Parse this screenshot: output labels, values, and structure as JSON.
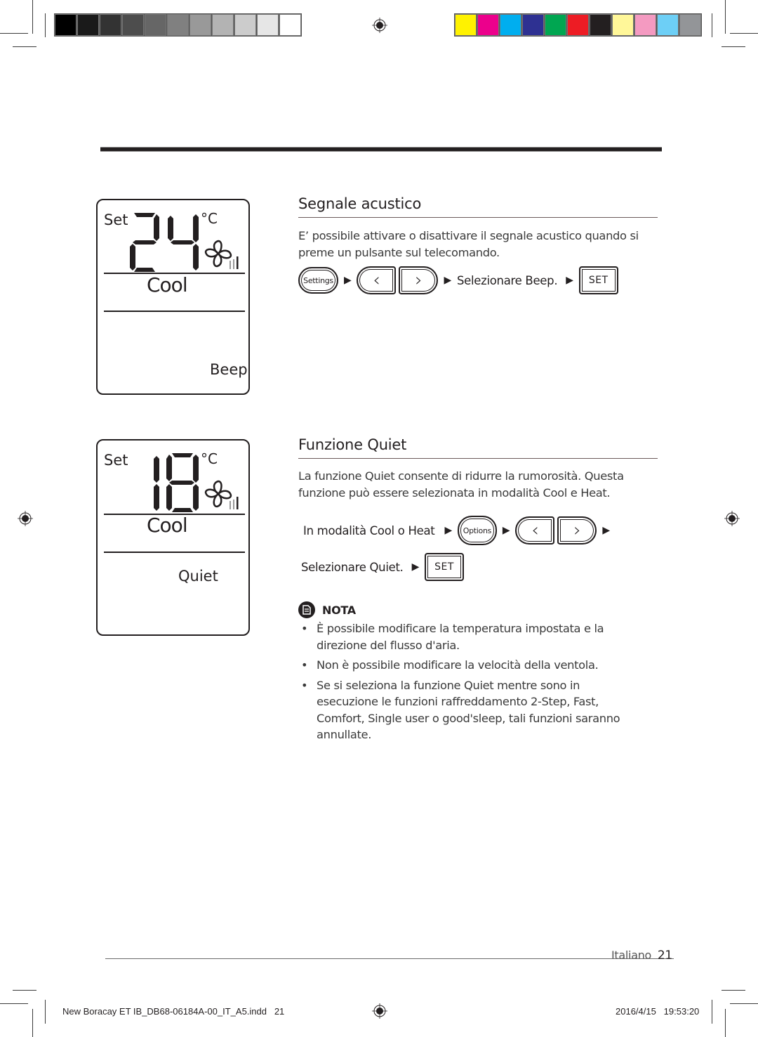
{
  "print_marks": {
    "grayscale_swatches": [
      "#000000",
      "#1a1a1a",
      "#333333",
      "#4d4d4d",
      "#666666",
      "#808080",
      "#999999",
      "#b3b3b3",
      "#cccccc",
      "#e6e6e6",
      "#ffffff"
    ],
    "color_swatches": [
      "#fff200",
      "#ec008c",
      "#00aeef",
      "#2e3192",
      "#00a651",
      "#ed1c24",
      "#231f20",
      "#fff799",
      "#f49ac1",
      "#6dcff6",
      "#939598"
    ]
  },
  "sections": [
    {
      "title": "Segnale acustico",
      "description": "E’ possibile attivare o disattivare il segnale acustico quando si preme un pulsante sul telecomando.",
      "lcd": {
        "set_label": "Set",
        "temperature": "24",
        "unit": "°C",
        "mode": "Cool",
        "function": "Beep"
      },
      "steps": {
        "settings_button": "Settings",
        "left_arrow": "‹",
        "right_arrow": "›",
        "select_text": "Selezionare Beep.",
        "set_button": "SET"
      }
    },
    {
      "title": "Funzione Quiet",
      "description": "La funzione Quiet consente di ridurre la rumorosità. Questa funzione può essere selezionata in modalità Cool e Heat.",
      "lcd": {
        "set_label": "Set",
        "temperature": "18",
        "unit": "°C",
        "mode": "Cool",
        "function": "Quiet"
      },
      "steps": {
        "mode_text": "In modalità Cool o Heat",
        "options_button": "Options",
        "left_arrow": "‹",
        "right_arrow": "›",
        "select_text": "Selezionare Quiet.",
        "set_button": "SET"
      }
    }
  ],
  "note": {
    "label": "NOTA",
    "items": [
      "È possibile modificare la temperatura impostata e la direzione del flusso d'aria.",
      "Non è possibile modificare la velocità della ventola.",
      "Se si seleziona la funzione Quiet mentre sono in esecuzione le funzioni raffreddamento 2-Step, Fast, Comfort, Single user o good'sleep, tali funzioni saranno annullate."
    ],
    "bullet": "•"
  },
  "footer": {
    "language": "Italiano",
    "page_number": "21",
    "file_slug": "New Boracay ET IB_DB68-06184A-00_IT_A5.indd   21",
    "timestamp": "2016/4/15   19:53:20"
  },
  "glyphs": {
    "step_arrow": "▶"
  }
}
